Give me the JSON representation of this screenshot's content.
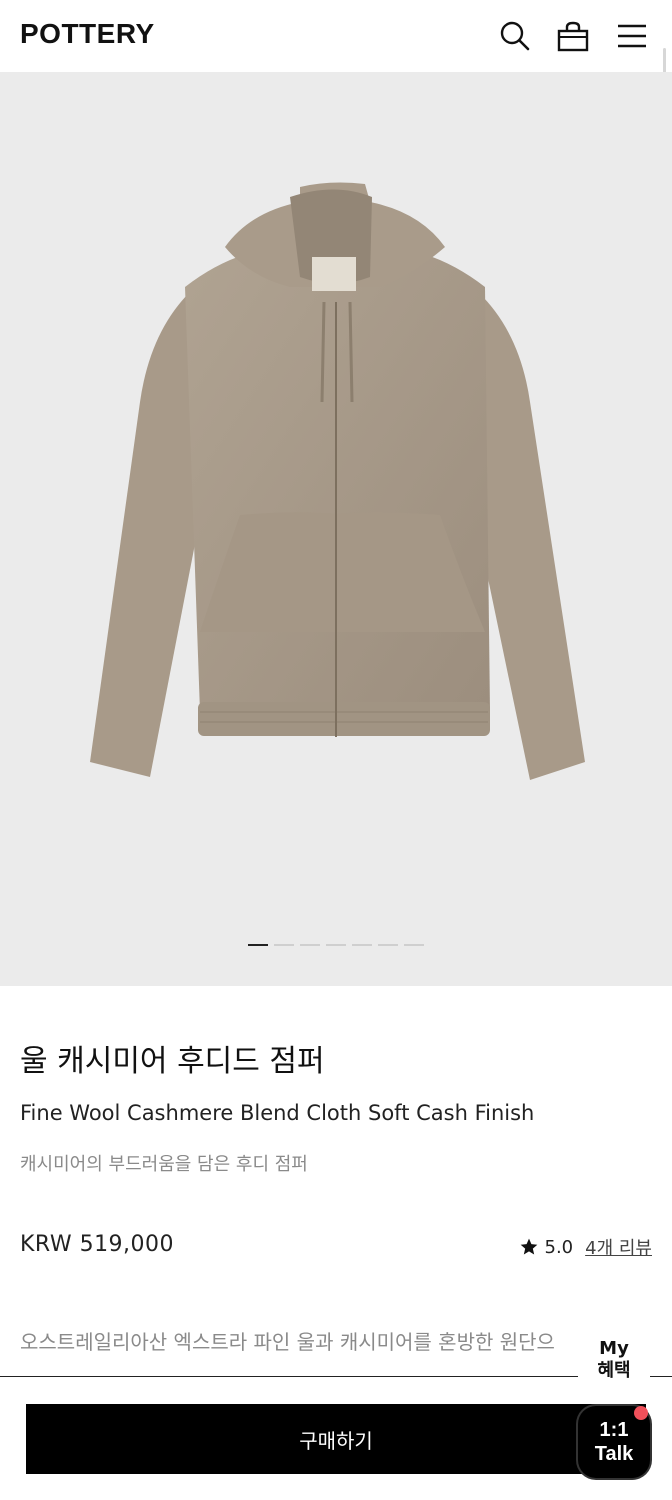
{
  "header": {
    "logo": "POTTERY",
    "icons": [
      "search-icon",
      "bag-icon",
      "menu-icon"
    ]
  },
  "gallery": {
    "image_alt": "hooded zip jacket",
    "slide_count": 7,
    "active_slide": 1,
    "colors": {
      "background": "#ebebeb",
      "fabric": "#a99a89"
    }
  },
  "product": {
    "title_ko": "울 캐시미어 후디드 점퍼",
    "title_en": "Fine Wool Cashmere Blend Cloth Soft Cash Finish",
    "subtitle": "캐시미어의 부드러움을 담은 후디 점퍼",
    "price": "KRW 519,000",
    "rating": "5.0",
    "review_link": "4개 리뷰",
    "description": "오스트레일리아산 엑스트라 파인 울과 캐시미어를 혼방한 원단으"
  },
  "actions": {
    "buy_label": "구매하기",
    "my_benefit_line1": "My",
    "my_benefit_line2": "혜택",
    "talk_line1": "1:1",
    "talk_line2": "Talk"
  },
  "colors": {
    "accent": "#000000",
    "notification": "#f0505a",
    "muted_text": "#8a8a8a"
  }
}
